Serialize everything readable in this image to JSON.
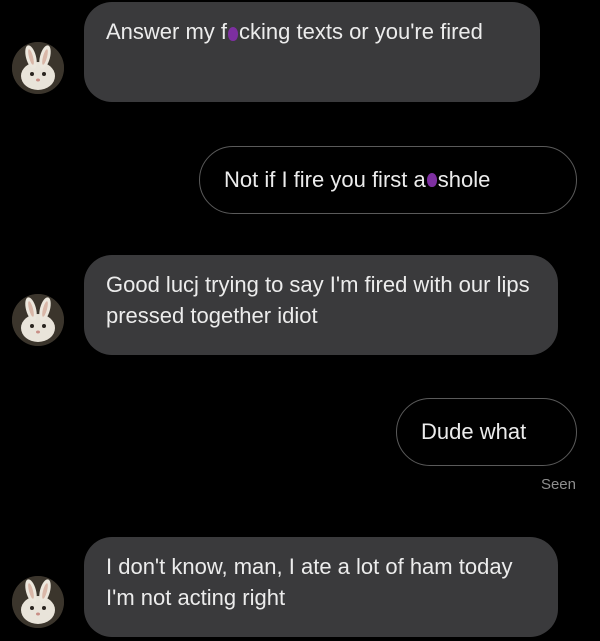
{
  "messages": [
    {
      "direction": "incoming",
      "text_before": "Answer my f",
      "text_after": "cking texts or you're fired",
      "censored": true
    },
    {
      "direction": "outgoing",
      "text_before": "Not if I fire you first a",
      "text_after": "shole",
      "censored": true
    },
    {
      "direction": "incoming",
      "text": "Good lucj trying to say I'm fired with our lips pressed together idiot"
    },
    {
      "direction": "outgoing",
      "text": "Dude what"
    },
    {
      "direction": "incoming",
      "text": "I don't know, man, I ate a lot of ham today I'm not acting right"
    }
  ],
  "status": {
    "seen_label": "Seen"
  },
  "avatar_icon": "bunny-avatar-icon",
  "colors": {
    "background": "#000000",
    "incoming_bubble": "#3a3a3c",
    "outgoing_border": "#5a5a5a",
    "text": "#ececec",
    "censor_mark": "#7d2fa0",
    "seen_text": "#8e8e8e"
  }
}
